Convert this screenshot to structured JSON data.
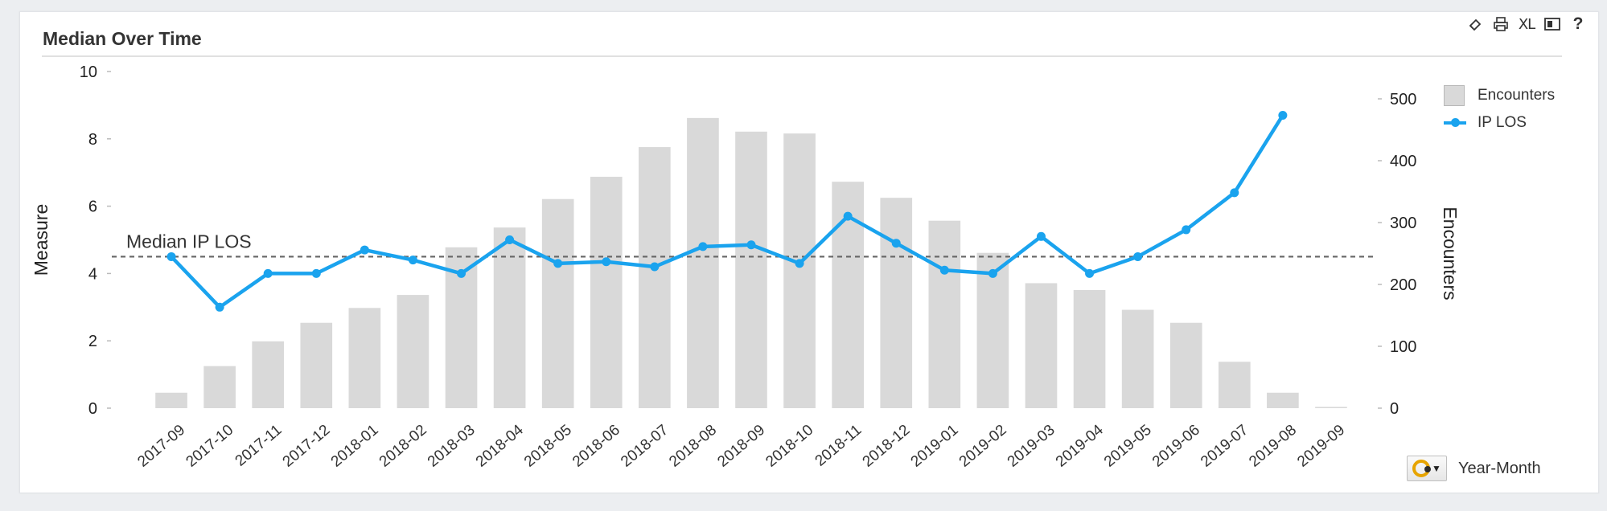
{
  "panel": {
    "title": "Median Over Time",
    "toolbar": [
      {
        "icon": "eraser-icon"
      },
      {
        "icon": "print-icon"
      },
      {
        "icon": "excel-export-icon",
        "label": "XL"
      },
      {
        "icon": "panel-toggle-icon"
      },
      {
        "icon": "help-icon",
        "label": "?"
      }
    ],
    "x_dimension_label": "Year-Month"
  },
  "legend": {
    "items": [
      {
        "label": "Encounters",
        "kind": "bar",
        "color": "#d9d9d9"
      },
      {
        "label": "IP LOS",
        "kind": "line",
        "color": "#1aa3ee"
      }
    ]
  },
  "chart_data": {
    "type": "bar",
    "categories": [
      "2017-09",
      "2017-10",
      "2017-11",
      "2017-12",
      "2018-01",
      "2018-02",
      "2018-03",
      "2018-04",
      "2018-05",
      "2018-06",
      "2018-07",
      "2018-08",
      "2018-09",
      "2018-10",
      "2018-11",
      "2018-12",
      "2019-01",
      "2019-02",
      "2019-03",
      "2019-04",
      "2019-05",
      "2019-06",
      "2019-07",
      "2019-08",
      "2019-09"
    ],
    "series": [
      {
        "name": "Encounters",
        "type": "bar",
        "axis": "right",
        "color": "#d9d9d9",
        "values": [
          25,
          68,
          108,
          138,
          162,
          183,
          260,
          292,
          338,
          374,
          422,
          469,
          447,
          444,
          366,
          340,
          303,
          251,
          202,
          191,
          159,
          138,
          75,
          25,
          2
        ]
      },
      {
        "name": "IP LOS",
        "type": "line",
        "axis": "left",
        "color": "#1aa3ee",
        "values": [
          4.5,
          3.0,
          4.0,
          4.0,
          4.7,
          4.4,
          4.0,
          5.0,
          4.3,
          4.35,
          4.2,
          4.8,
          4.85,
          4.3,
          5.7,
          4.9,
          4.1,
          4.0,
          5.1,
          4.0,
          4.5,
          5.3,
          6.4,
          8.7,
          null
        ]
      }
    ],
    "reference_line": {
      "label": "Median IP LOS",
      "value": 4.5,
      "axis": "left",
      "style": "dashed"
    },
    "y_left": {
      "label": "Measure",
      "ylim": [
        0,
        10
      ],
      "ticks": [
        0,
        2,
        4,
        6,
        8,
        10
      ]
    },
    "y_right": {
      "label": "Encounters",
      "ylim": [
        0,
        500
      ],
      "ticks": [
        0,
        100,
        200,
        300,
        400,
        500
      ]
    },
    "xlabel": "",
    "grid": false,
    "legend_position": "top-right"
  }
}
